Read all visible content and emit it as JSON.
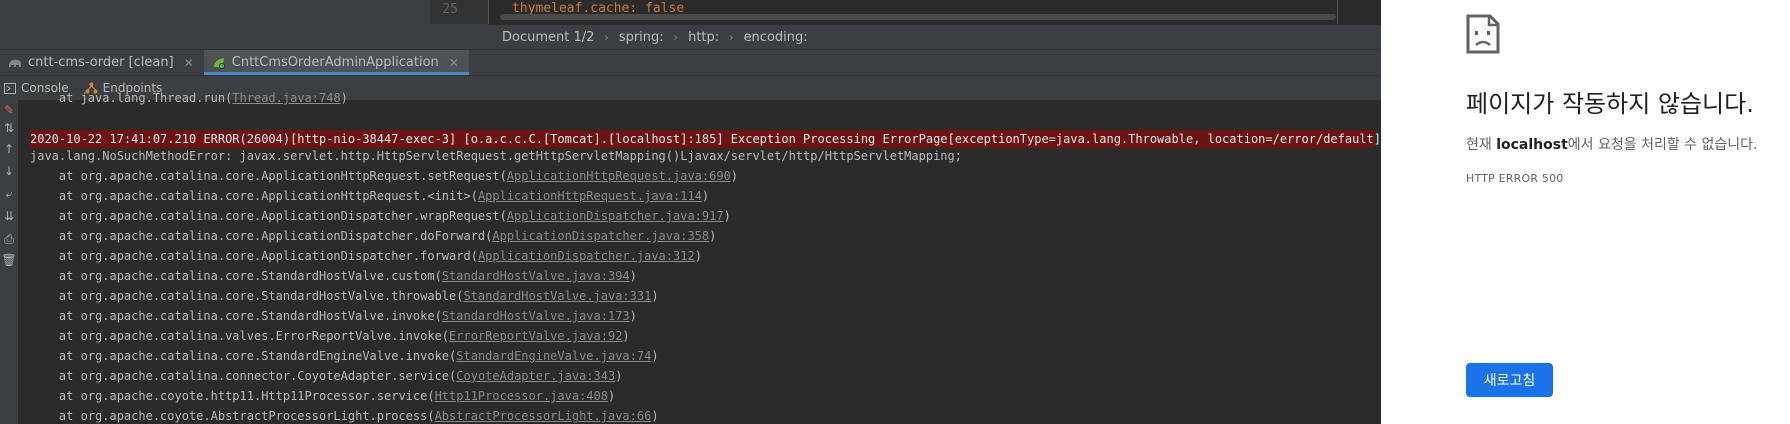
{
  "editor": {
    "line_number": "25",
    "code_key": "thymeleaf.cache",
    "code_sep": ": ",
    "code_value": "false"
  },
  "breadcrumbs": [
    "Document 1/2",
    "spring:",
    "http:",
    "encoding:"
  ],
  "run_tabs": [
    {
      "label": "cntt-cms-order [clean]"
    },
    {
      "label": "CnttCmsOrderAdminApplication"
    }
  ],
  "sub_tabs": {
    "console": "Console",
    "endpoints": "Endpoints"
  },
  "console": {
    "truncated_line_prefix": "    at java.lang.Thread.run(",
    "truncated_line_link": "Thread.java:748",
    "truncated_line_suffix": ")",
    "error_line": "2020-10-22 17:41:07.210 ERROR(26004)[http-nio-38447-exec-3] [o.a.c.c.C.[Tomcat].[localhost]:185] Exception Processing ErrorPage[exceptionType=java.lang.Throwable, location=/error/default]",
    "exception_line": "java.lang.NoSuchMethodError: javax.servlet.http.HttpServletRequest.getHttpServletMapping()Ljavax/servlet/http/HttpServletMapping;",
    "stack": [
      {
        "prefix": "    at org.apache.catalina.core.ApplicationHttpRequest.setRequest(",
        "link": "ApplicationHttpRequest.java:690",
        "suffix": ")"
      },
      {
        "prefix": "    at org.apache.catalina.core.ApplicationHttpRequest.<init>(",
        "link": "ApplicationHttpRequest.java:114",
        "suffix": ")"
      },
      {
        "prefix": "    at org.apache.catalina.core.ApplicationDispatcher.wrapRequest(",
        "link": "ApplicationDispatcher.java:917",
        "suffix": ")"
      },
      {
        "prefix": "    at org.apache.catalina.core.ApplicationDispatcher.doForward(",
        "link": "ApplicationDispatcher.java:358",
        "suffix": ")"
      },
      {
        "prefix": "    at org.apache.catalina.core.ApplicationDispatcher.forward(",
        "link": "ApplicationDispatcher.java:312",
        "suffix": ")"
      },
      {
        "prefix": "    at org.apache.catalina.core.StandardHostValve.custom(",
        "link": "StandardHostValve.java:394",
        "suffix": ")"
      },
      {
        "prefix": "    at org.apache.catalina.core.StandardHostValve.throwable(",
        "link": "StandardHostValve.java:331",
        "suffix": ")"
      },
      {
        "prefix": "    at org.apache.catalina.core.StandardHostValve.invoke(",
        "link": "StandardHostValve.java:173",
        "suffix": ")"
      },
      {
        "prefix": "    at org.apache.catalina.valves.ErrorReportValve.invoke(",
        "link": "ErrorReportValve.java:92",
        "suffix": ")"
      },
      {
        "prefix": "    at org.apache.catalina.core.StandardEngineValve.invoke(",
        "link": "StandardEngineValve.java:74",
        "suffix": ")"
      },
      {
        "prefix": "    at org.apache.catalina.connector.CoyoteAdapter.service(",
        "link": "CoyoteAdapter.java:343",
        "suffix": ")"
      },
      {
        "prefix": "    at org.apache.coyote.http11.Http11Processor.service(",
        "link": "Http11Processor.java:408",
        "suffix": ")"
      },
      {
        "prefix": "    at org.apache.coyote.AbstractProcessorLight.process(",
        "link": "AbstractProcessorLight.java:66",
        "suffix": ")"
      }
    ]
  },
  "browser": {
    "title": "페이지가 작동하지 않습니다.",
    "desc_prefix": "현재 ",
    "desc_host": "localhost",
    "desc_suffix": "에서 요청을 처리할 수 없습니다.",
    "error_code": "HTTP ERROR 500",
    "reload_label": "새로고침"
  },
  "colors": {
    "error_band": "#6e1313",
    "active_tab_underline": "#4a88c7",
    "reload_button": "#1a73e8"
  }
}
